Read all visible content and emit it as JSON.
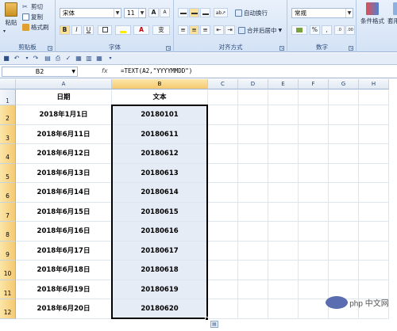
{
  "ribbon": {
    "clipboard": {
      "paste": "粘贴",
      "cut": "剪切",
      "copy": "复制",
      "format_painter": "格式刷",
      "group_label": "剪贴板"
    },
    "font": {
      "name": "宋体",
      "size": "11",
      "grow": "A",
      "shrink": "A",
      "bold": "B",
      "italic": "I",
      "underline": "U",
      "font_color_letter": "A",
      "phonetic": "变",
      "group_label": "字体"
    },
    "alignment": {
      "wrap_text": "自动换行",
      "merge_center": "合并后居中",
      "group_label": "对齐方式"
    },
    "number": {
      "format": "常规",
      "percent": "%",
      "comma": ",",
      "group_label": "数字"
    },
    "styles": {
      "conditional_formatting": "条件格式",
      "format_as_table": "套用表格"
    }
  },
  "formula_bar": {
    "name_box": "B2",
    "fx": "fx",
    "formula": "=TEXT(A2,\"YYYYMMDD\")"
  },
  "columns": [
    "A",
    "B",
    "C",
    "D",
    "E",
    "F",
    "G",
    "H"
  ],
  "rows": [
    {
      "num": "1",
      "a": "日期",
      "b": "文本"
    },
    {
      "num": "2",
      "a": "2018年1月1日",
      "b": "20180101"
    },
    {
      "num": "3",
      "a": "2018年6月11日",
      "b": "20180611"
    },
    {
      "num": "4",
      "a": "2018年6月12日",
      "b": "20180612"
    },
    {
      "num": "5",
      "a": "2018年6月13日",
      "b": "20180613"
    },
    {
      "num": "6",
      "a": "2018年6月14日",
      "b": "20180614"
    },
    {
      "num": "7",
      "a": "2018年6月15日",
      "b": "20180615"
    },
    {
      "num": "8",
      "a": "2018年6月16日",
      "b": "20180616"
    },
    {
      "num": "9",
      "a": "2018年6月17日",
      "b": "20180617"
    },
    {
      "num": "10",
      "a": "2018年6月18日",
      "b": "20180618"
    },
    {
      "num": "11",
      "a": "2018年6月19日",
      "b": "20180619"
    },
    {
      "num": "12",
      "a": "2018年6月20日",
      "b": "20180620"
    }
  ],
  "watermark": {
    "text": "php 中文网"
  },
  "colors": {
    "selection_border": "#000000",
    "selection_fill": "#e5ecf6",
    "header_highlight": "#f6c970"
  }
}
